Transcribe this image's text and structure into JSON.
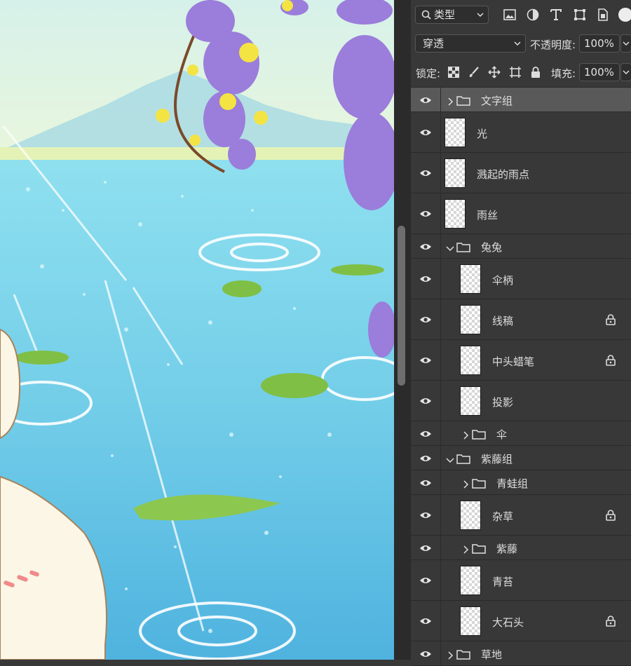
{
  "toolbar": {
    "filter_label": "类型",
    "blend_mode": "穿透",
    "opacity_label": "不透明度:",
    "opacity_value": "100%",
    "lock_label": "锁定:",
    "fill_label": "填充:",
    "fill_value": "100%"
  },
  "layers": [
    {
      "name": "文字组",
      "type": "group",
      "expanded": false,
      "indent": 0,
      "locked": false,
      "selected": true
    },
    {
      "name": "光",
      "type": "layer",
      "indent": 0,
      "locked": false
    },
    {
      "name": "溅起的雨点",
      "type": "layer",
      "indent": 0,
      "locked": false
    },
    {
      "name": "雨丝",
      "type": "layer",
      "indent": 0,
      "locked": false
    },
    {
      "name": "兔兔",
      "type": "group",
      "expanded": true,
      "indent": 0,
      "locked": false
    },
    {
      "name": "伞柄",
      "type": "layer",
      "indent": 1,
      "locked": false
    },
    {
      "name": "线稿",
      "type": "layer",
      "indent": 1,
      "locked": true
    },
    {
      "name": "中头蜡笔",
      "type": "layer",
      "indent": 1,
      "locked": true
    },
    {
      "name": "投影",
      "type": "layer",
      "indent": 1,
      "locked": false
    },
    {
      "name": "伞",
      "type": "group",
      "expanded": false,
      "indent": 1,
      "locked": false
    },
    {
      "name": "紫藤组",
      "type": "group",
      "expanded": true,
      "indent": 0,
      "locked": false
    },
    {
      "name": "青蛙组",
      "type": "group",
      "expanded": false,
      "indent": 1,
      "locked": false
    },
    {
      "name": "杂草",
      "type": "layer",
      "indent": 1,
      "locked": true
    },
    {
      "name": "紫藤",
      "type": "group",
      "expanded": false,
      "indent": 1,
      "locked": false
    },
    {
      "name": "青苔",
      "type": "layer",
      "indent": 1,
      "locked": false
    },
    {
      "name": "大石头",
      "type": "layer",
      "indent": 1,
      "locked": true
    },
    {
      "name": "草地",
      "type": "group",
      "expanded": false,
      "indent": 0,
      "locked": false
    }
  ]
}
